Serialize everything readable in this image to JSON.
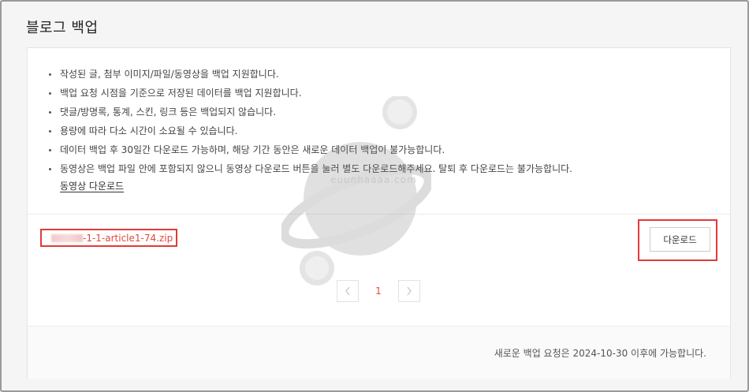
{
  "page": {
    "title": "블로그 백업"
  },
  "notices": [
    "작성된 글, 첨부 이미지/파일/동영상을 백업 지원합니다.",
    "백업 요청 시점을 기준으로 저장된 데이터를 백업 지원합니다.",
    "댓글/방명록, 통계, 스킨, 링크 등은 백업되지 않습니다.",
    "용량에 따라 다소 시간이 소요될 수 있습니다.",
    "데이터 백업 후 30일간 다운로드 가능하며, 해당 기간 동안은 새로운 데이터 백업이 불가능합니다.",
    "동영상은 백업 파일 안에 포함되지 않으니 동영상 다운로드 버튼을 눌러 별도 다운로드해주세요. 탈퇴 후 다운로드는 불가능합니다."
  ],
  "video_download_link": "동영상 다운로드",
  "backup_file": {
    "name": "-1-1-article1-74.zip",
    "download_label": "다운로드"
  },
  "pagination": {
    "current_page": "1",
    "prev_icon": "chevron-left-icon",
    "next_icon": "chevron-right-icon"
  },
  "footer": {
    "note": "새로운 백업 요청은 2024-10-30 이후에 가능합니다."
  },
  "watermark": {
    "text": "euunhaaaa.com"
  },
  "colors": {
    "accent_red": "#e04a3a",
    "highlight_border": "#e23a3a",
    "page_bg": "#f5f5f5"
  }
}
